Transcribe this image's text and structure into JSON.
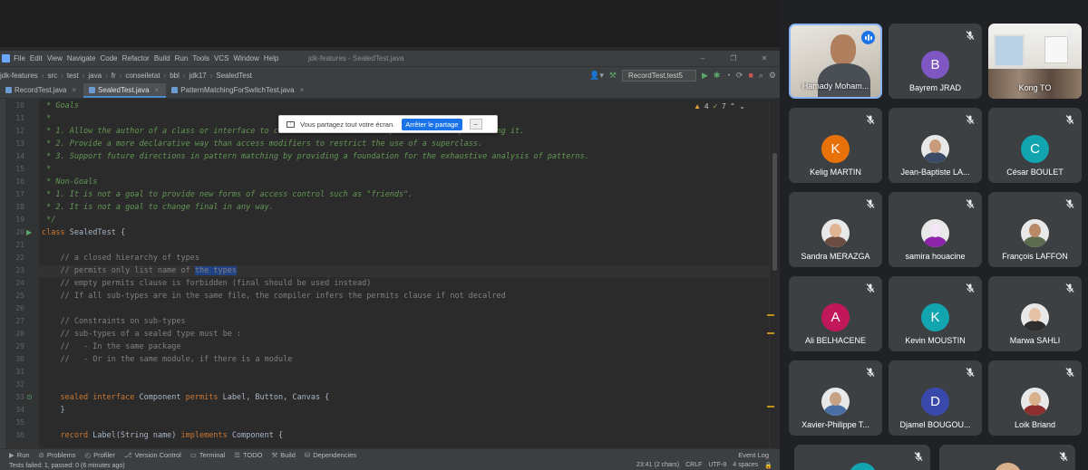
{
  "ide": {
    "menu": [
      "File",
      "Edit",
      "View",
      "Navigate",
      "Code",
      "Refactor",
      "Build",
      "Run",
      "Tools",
      "VCS",
      "Window",
      "Help"
    ],
    "window_title": "jdk-features - SealedTest.java",
    "breadcrumbs": [
      "jdk-features",
      "src",
      "test",
      "java",
      "fr",
      "conseiletat",
      "bbl",
      "jdk17",
      "SealedTest"
    ],
    "run_config": "RecordTest.test5",
    "tabs": [
      {
        "label": "RecordTest.java",
        "active": false
      },
      {
        "label": "SealedTest.java",
        "active": true
      },
      {
        "label": "PatternMatchingForSwitchTest.java",
        "active": false
      }
    ],
    "inspection": {
      "warnings": "4",
      "weak": "7"
    },
    "code_lines": [
      {
        "n": "10",
        "cls": "c-doc",
        "text": " * Goals"
      },
      {
        "n": "11",
        "cls": "c-doc",
        "text": " *"
      },
      {
        "n": "12",
        "cls": "c-doc",
        "text": " * 1. Allow the author of a class or interface to control which code is responsible for implementing it."
      },
      {
        "n": "13",
        "cls": "c-doc",
        "text": " * 2. Provide a more declarative way than access modifiers to restrict the use of a superclass."
      },
      {
        "n": "14",
        "cls": "c-doc",
        "text": " * 3. Support future directions in pattern matching by providing a foundation for the exhaustive analysis of patterns."
      },
      {
        "n": "15",
        "cls": "c-doc",
        "text": " *"
      },
      {
        "n": "16",
        "cls": "c-doc",
        "text": " * Non-Goals"
      },
      {
        "n": "17",
        "cls": "c-doc",
        "text": " * 1. It is not a goal to provide new forms of access control such as \"friends\"."
      },
      {
        "n": "18",
        "cls": "c-doc",
        "text": " * 2. It is not a goal to change final in any way."
      },
      {
        "n": "19",
        "cls": "c-doc",
        "text": " */"
      },
      {
        "n": "20",
        "cls": "c-txt",
        "kw": "class",
        "text": " SealedTest {"
      },
      {
        "n": "21",
        "cls": "c-txt",
        "text": ""
      },
      {
        "n": "22",
        "cls": "c-com",
        "text": "    // a closed hierarchy of types"
      },
      {
        "n": "23",
        "cls": "c-com",
        "text": "    // permits only list name of ",
        "sel": "the types"
      },
      {
        "n": "24",
        "cls": "c-com",
        "text": "    // empty permits clause is forbidden (final should be used instead)"
      },
      {
        "n": "25",
        "cls": "c-com",
        "text": "    // If all sub-types are in the same file, the compiler infers the permits clause if not decalred"
      },
      {
        "n": "26",
        "cls": "c-txt",
        "text": ""
      },
      {
        "n": "27",
        "cls": "c-com",
        "text": "    // Constraints on sub-types"
      },
      {
        "n": "28",
        "cls": "c-com",
        "text": "    // sub-types of a sealed type must be :"
      },
      {
        "n": "29",
        "cls": "c-com",
        "text": "    //   - In the same package"
      },
      {
        "n": "30",
        "cls": "c-com",
        "text": "    //   - Or in the same module, if there is a module"
      },
      {
        "n": "31",
        "cls": "c-txt",
        "text": ""
      },
      {
        "n": "32",
        "cls": "c-txt",
        "text": ""
      },
      {
        "n": "33",
        "cls": "c-txt",
        "kw": "    sealed interface",
        "text": " Component ",
        "kw2": "permits",
        "text2": " Label, Button, Canvas {"
      },
      {
        "n": "34",
        "cls": "c-txt",
        "text": "    }"
      },
      {
        "n": "35",
        "cls": "c-txt",
        "text": ""
      },
      {
        "n": "36",
        "cls": "c-txt",
        "kw": "    record",
        "text": " Label(String name) ",
        "kw2": "implements",
        "text2": " Component {"
      }
    ],
    "share_bar": {
      "message": "Vous partagez tout votre écran.",
      "stop_label": "Arrêter le partage"
    },
    "tool_windows": [
      "Run",
      "Problems",
      "Profiler",
      "Version Control",
      "Terminal",
      "TODO",
      "Build",
      "Dependencies"
    ],
    "event_log": "Event Log",
    "status_left": "Tests failed: 1, passed: 0 (6 minutes ago)",
    "status_right": [
      "23:41 (2 chars)",
      "CRLF",
      "UTF-8",
      "4 spaces"
    ]
  },
  "participants": [
    {
      "name": "Hamady Moham...",
      "type": "video",
      "speaking": true
    },
    {
      "name": "Bayrem JRAD",
      "type": "initial",
      "initial": "B",
      "color": "#7e57c2",
      "muted": true
    },
    {
      "name": "Kong TO",
      "type": "video-room",
      "muted": true
    },
    {
      "name": "Kelig MARTIN",
      "type": "initial",
      "initial": "K",
      "color": "#e8710a",
      "muted": true
    },
    {
      "name": "Jean-Baptiste LA...",
      "type": "photo",
      "face": "#c99b7a",
      "body": "#3b4a66",
      "muted": true
    },
    {
      "name": "César BOULET",
      "type": "initial",
      "initial": "C",
      "color": "#12a4af",
      "muted": true
    },
    {
      "name": "Sandra MERAZGA",
      "type": "photo",
      "face": "#e0b392",
      "body": "#6d4c41",
      "muted": true
    },
    {
      "name": "samira houacine",
      "type": "photo",
      "face": "#f3e5f5",
      "body": "#8e24aa",
      "muted": true
    },
    {
      "name": "François LAFFON",
      "type": "photo",
      "face": "#b98a6a",
      "body": "#5d6b4f",
      "muted": true
    },
    {
      "name": "Ali BELHACENE",
      "type": "initial",
      "initial": "A",
      "color": "#c2185b",
      "muted": true
    },
    {
      "name": "Kevin MOUSTIN",
      "type": "initial",
      "initial": "K",
      "color": "#12a4af",
      "muted": true
    },
    {
      "name": "Marwa SAHLI",
      "type": "photo",
      "face": "#e6c2a6",
      "body": "#2e2e2e",
      "muted": true
    },
    {
      "name": "Xavier-Philippe T...",
      "type": "photo",
      "face": "#c7a183",
      "body": "#4a6fa5",
      "muted": true
    },
    {
      "name": "Djamel BOUGOU...",
      "type": "initial",
      "initial": "D",
      "color": "#3949ab",
      "muted": true
    },
    {
      "name": "Loik Briand",
      "type": "photo",
      "face": "#d8b08c",
      "body": "#8d2f2f",
      "muted": true
    }
  ]
}
